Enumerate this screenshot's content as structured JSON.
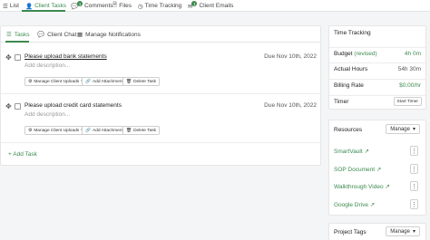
{
  "topnav": {
    "tabs": [
      {
        "label": "List",
        "icon": "list-icon"
      },
      {
        "label": "Client Tasks",
        "icon": "person-icon",
        "active": true
      },
      {
        "label": "Comments",
        "icon": "comment-icon",
        "badge": "1"
      },
      {
        "label": "Files",
        "icon": "file-icon"
      },
      {
        "label": "Time Tracking",
        "icon": "clock-icon"
      },
      {
        "label": "Client Emails",
        "icon": "envelope-icon",
        "badge": "1"
      }
    ]
  },
  "subtabs": [
    {
      "label": "Tasks",
      "icon": "list-icon",
      "active": true
    },
    {
      "label": "Client Chat",
      "icon": "chat-icon"
    },
    {
      "label": "Manage Notifications",
      "icon": "calendar-icon"
    }
  ],
  "tasks": [
    {
      "title": "Please upload bank statements",
      "placeholder": "Add description...",
      "due": "Due Nov 10th, 2022",
      "buttons": {
        "manage": "Manage Client Uploads",
        "attach": "Add Attachment",
        "delete": "Delete Task"
      }
    },
    {
      "title": "Please upload credit card statements",
      "placeholder": "Add description...",
      "due": "Due Nov 10th, 2022",
      "buttons": {
        "manage": "Manage Client Uploads",
        "attach": "Add Attachment",
        "delete": "Delete Task"
      }
    }
  ],
  "add_task": "+ Add Task",
  "time_tracking": {
    "title": "Time Tracking",
    "rows": [
      {
        "label": "Budget",
        "label_extra": "(revised)",
        "value": "4h 0m"
      },
      {
        "label": "Actual Hours",
        "value": "54h 30m"
      },
      {
        "label": "Billing Rate",
        "value": "$0.00/hr"
      }
    ],
    "timer_label": "Timer",
    "start_timer": "Start Timer"
  },
  "resources": {
    "title": "Resources",
    "manage": "Manage",
    "items": [
      "SmartVault",
      "SOP Document",
      "Walkthrough Video",
      "Google Drive"
    ]
  },
  "project_tags": {
    "title": "Project Tags",
    "manage": "Manage"
  },
  "colors": {
    "accent": "#3c8a4e"
  }
}
